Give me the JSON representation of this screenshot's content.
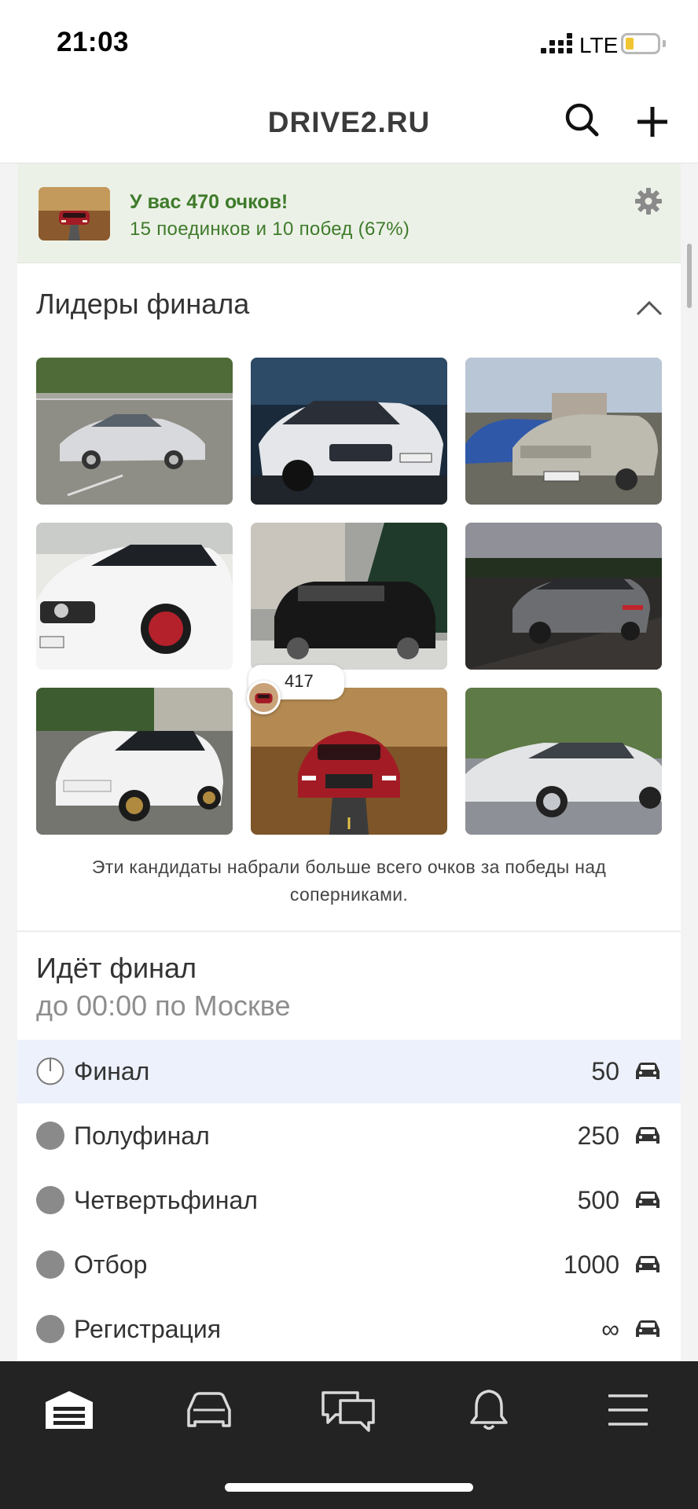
{
  "status_bar": {
    "time": "21:03",
    "network": "LTE"
  },
  "header": {
    "title": "DRIVE2.RU",
    "icons": [
      "search-icon",
      "plus-icon"
    ]
  },
  "score": {
    "title": "У вас 470 очков!",
    "subtitle": "15 поединков и 10 побед (67%)",
    "icon": "gear-icon"
  },
  "leaders": {
    "title": "Лидеры финала",
    "vote_count": "417",
    "note": "Эти кандидаты набрали больше всего очков за победы над соперниками."
  },
  "final": {
    "title": "Идёт финал",
    "subtitle": "до 00:00 по Москве",
    "stages": [
      {
        "name": "Финал",
        "count": "50",
        "active": true
      },
      {
        "name": "Полуфинал",
        "count": "250",
        "active": false
      },
      {
        "name": "Четвертьфинал",
        "count": "500",
        "active": false
      },
      {
        "name": "Отбор",
        "count": "1000",
        "active": false
      },
      {
        "name": "Регистрация",
        "count": "∞",
        "active": false
      }
    ]
  },
  "bottom_nav": [
    "garage-icon",
    "car-icon",
    "messages-icon",
    "bell-icon",
    "menu-icon"
  ],
  "colors": {
    "accent_green": "#3e7b2b",
    "banner_bg": "#ecf1e7",
    "active_row": "#edf1fb",
    "nav_bg": "#232323"
  }
}
